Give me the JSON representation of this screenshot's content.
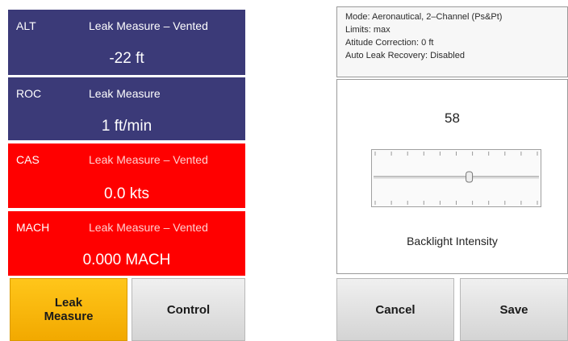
{
  "tiles": [
    {
      "name": "ALT",
      "mode": "Leak Measure – Vented",
      "reading": "-22 ft"
    },
    {
      "name": "ROC",
      "mode": "Leak Measure",
      "reading": "1 ft/min"
    },
    {
      "name": "CAS",
      "mode": "Leak Measure – Vented",
      "reading": "0.0 kts"
    },
    {
      "name": "MACH",
      "mode": "Leak Measure – Vented",
      "reading": "0.000 MACH"
    }
  ],
  "buttons": {
    "leak_measure": "Leak Measure",
    "control": "Control",
    "cancel": "Cancel",
    "save": "Save"
  },
  "info": {
    "mode": "Mode: Aeronautical, 2–Channel (Ps&Pt)",
    "limits": "Limits: max",
    "altitude_correction": "Atitude Correction: 0 ft",
    "auto_leak": "Auto Leak Recovery: Disabled"
  },
  "backlight": {
    "value": "58",
    "label": "Backlight Intensity",
    "level_fraction": 0.58
  },
  "colors": {
    "tile_blue": "#3b3a78",
    "tile_red": "#ff0000",
    "active_button": "#f2a900"
  }
}
